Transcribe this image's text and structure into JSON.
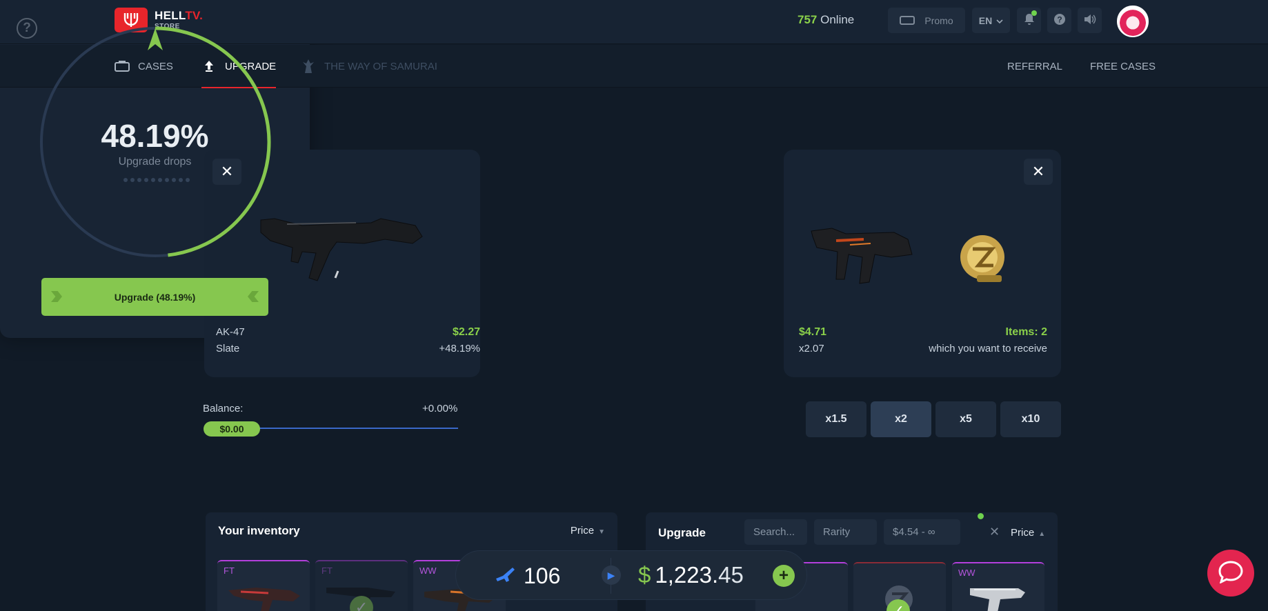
{
  "header": {
    "logo_top": "HELL",
    "logo_top_accent": "TV.",
    "logo_bottom": "STORE",
    "online_count": "757",
    "online_label": "Online",
    "promo_label": "Promo",
    "lang": "EN"
  },
  "nav": {
    "cases": "CASES",
    "upgrade": "UPGRADE",
    "samurai": "THE WAY OF SAMURAI",
    "referral": "REFERRAL",
    "free_cases": "FREE CASES"
  },
  "left_item": {
    "weapon": "AK-47",
    "skin": "Slate",
    "price": "$2.27",
    "percent": "+48.19%"
  },
  "center": {
    "chance": "48.19%",
    "chance_value": 0.4819,
    "subtitle": "Upgrade drops",
    "button_label": "Upgrade (48.19%)"
  },
  "right_item": {
    "price": "$4.71",
    "multiplier": "x2.07",
    "items_label": "Items: 2",
    "items_sub": "which you want to receive"
  },
  "balance": {
    "label": "Balance:",
    "percent": "+0.00%",
    "amount": "$0.00"
  },
  "multipliers": [
    "x1.5",
    "x2",
    "x5",
    "x10"
  ],
  "inventory": {
    "title": "Your inventory",
    "sort": "Price",
    "cards": [
      "FT",
      "FT",
      "WW"
    ]
  },
  "upgrade_panel": {
    "title": "Upgrade",
    "search_placeholder": "Search...",
    "rarity": "Rarity",
    "price_range": "$4.54 - ∞",
    "sort": "Price",
    "cards": [
      "WW"
    ]
  },
  "bottom_bar": {
    "count": "106",
    "dollar": "$",
    "money_main": "1,223.",
    "money_cents": "45"
  },
  "colors": {
    "accent_green": "#86c74f",
    "brand_red": "#e8252b",
    "background": "#111b27"
  }
}
